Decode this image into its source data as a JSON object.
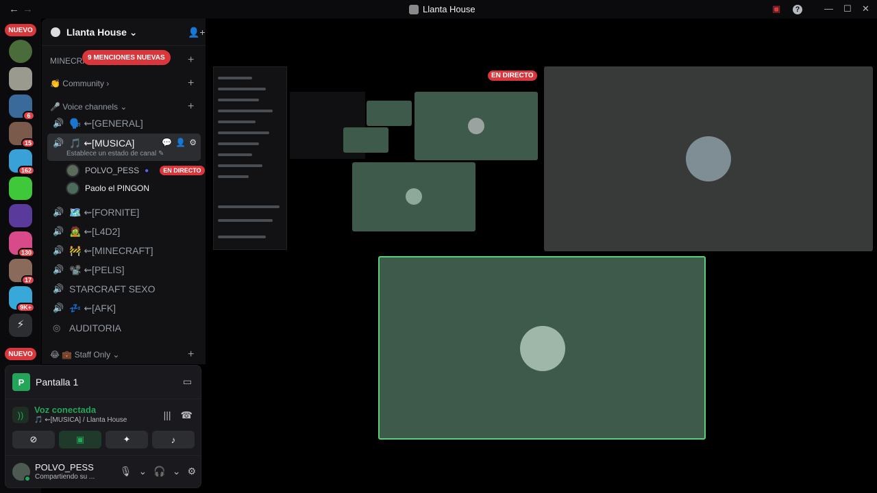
{
  "window": {
    "title": "Llanta House",
    "back": "←",
    "forward": "→",
    "ctrl_inbox": "▣",
    "ctrl_help": "?",
    "ctrl_min": "—",
    "ctrl_max": "☐",
    "ctrl_close": "✕"
  },
  "rail": {
    "nuevo_top": "NUEVO",
    "nuevo_bottom": "NUEVO",
    "badges": [
      "6",
      "15",
      "162",
      "130",
      "17",
      "9K+"
    ]
  },
  "server": {
    "name": "Llanta House ⌄",
    "mentions_pill": "9 MENCIONES NUEVAS",
    "categories": {
      "minecraft": "MINECRA",
      "community": "👏 Community ›",
      "voice": "🎤 Voice channels ⌄",
      "staff": "😂 💼 Staff Only ⌄"
    },
    "channels": [
      {
        "name": "🗣️ ⇜[GENERAL]"
      },
      {
        "name": "🎵 ⇜[MUSICA]",
        "status": "Establece un estado de canal ✎"
      },
      {
        "name": "🗺️ ⇜[FORNITE]"
      },
      {
        "name": "🧟 ⇜[L4D2]"
      },
      {
        "name": "🚧 ⇜[MINECRAFT]"
      },
      {
        "name": "📽️ ⇜[PELIS]"
      },
      {
        "name": "STARCRAFT SEXO"
      },
      {
        "name": "💤 ⇜[AFK]"
      },
      {
        "name": "AUDITORIA"
      }
    ],
    "voice_users": [
      {
        "name": "POLVO_PESS",
        "live": "EN DIRECTO"
      },
      {
        "name": "Paolo el PINGON"
      }
    ]
  },
  "panel": {
    "share_tile": "P",
    "share_title": "Pantalla 1",
    "conn_label": "Voz conectada",
    "conn_sub": "🎵 ⇜[MUSICA] / Llanta House",
    "user_name": "POLVO_PESS",
    "user_status": "Compartiendo su ..."
  },
  "stage": {
    "live_label": "EN DIRECTO"
  },
  "colors": {
    "accent_green": "#23a55a",
    "danger_red": "#da373c",
    "tile_green": "#3d5a4a"
  }
}
